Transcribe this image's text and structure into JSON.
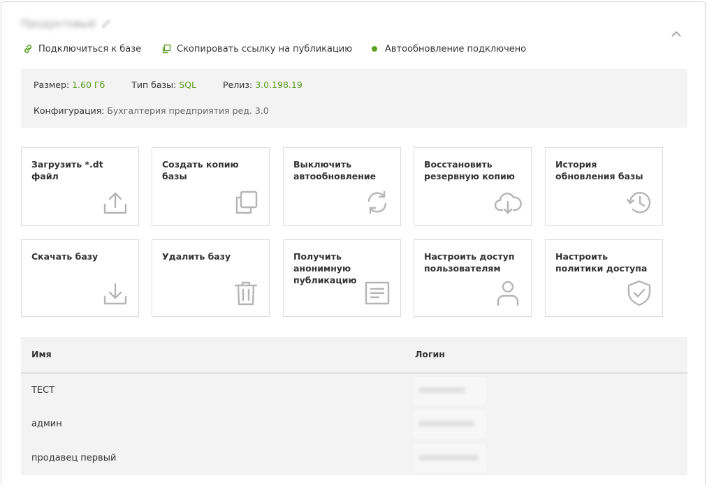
{
  "header": {
    "db_title": "Продуктовый",
    "collapse_icon": "chevron-up-icon"
  },
  "actions": {
    "connect_label": "Подключиться к базе",
    "copy_link_label": "Скопировать ссылку на публикацию",
    "autoupdate_status": "Автообновление подключено",
    "status_color": "#5aa320"
  },
  "info": {
    "size_label": "Размер:",
    "size_value": "1.60 Гб",
    "type_label": "Тип базы:",
    "type_value": "SQL",
    "release_label": "Релиз:",
    "release_value": "3.0.198.19",
    "config_label": "Конфигурация:",
    "config_value": "Бухгалтерия предприятия ред. 3.0"
  },
  "tiles": [
    {
      "label": "Загрузить *.dt файл",
      "icon": "upload-icon"
    },
    {
      "label": "Создать копию базы",
      "icon": "copy-icon"
    },
    {
      "label": "Выключить автообновление",
      "icon": "refresh-icon"
    },
    {
      "label": "Восстановить резервную копию",
      "icon": "cloud-download-icon"
    },
    {
      "label": "История обновления базы",
      "icon": "history-icon"
    },
    {
      "label": "Скачать базу",
      "icon": "download-icon"
    },
    {
      "label": "Удалить базу",
      "icon": "trash-icon"
    },
    {
      "label": "Получить анонимную публикацию",
      "icon": "document-icon"
    },
    {
      "label": "Настроить доступ пользователям",
      "icon": "user-icon"
    },
    {
      "label": "Настроить политики доступа",
      "icon": "shield-check-icon"
    }
  ],
  "users_table": {
    "col_name": "Имя",
    "col_login": "Логин",
    "rows": [
      {
        "name": "ТЕСТ",
        "login": "xxxxxxxxxx"
      },
      {
        "name": "админ",
        "login": "xxxxxxxxxxxx"
      },
      {
        "name": "продавец первый",
        "login": "xxxxxxxxxxxxx"
      }
    ]
  },
  "accent_color": "#5a9b1f",
  "icon_color": "#b5b5b5"
}
